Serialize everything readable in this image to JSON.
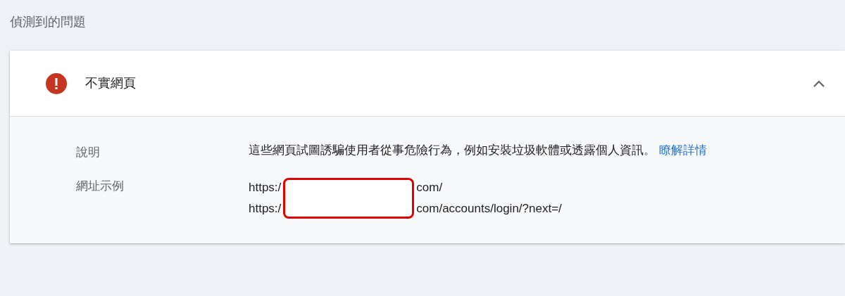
{
  "section_title": "偵測到的問題",
  "issue": {
    "title": "不實網頁",
    "expanded": true,
    "details": [
      {
        "kind": "text",
        "label": "說明",
        "text": "這些網頁試圖誘騙使用者從事危險行為，例如安裝垃圾軟體或透露個人資訊。",
        "link": "瞭解詳情"
      },
      {
        "kind": "urls",
        "label": "網址示例",
        "urls": [
          {
            "prefix": "https:/",
            "suffix": "com/"
          },
          {
            "prefix": "https:/",
            "suffix": "com/accounts/login/?next=/"
          }
        ]
      }
    ]
  }
}
